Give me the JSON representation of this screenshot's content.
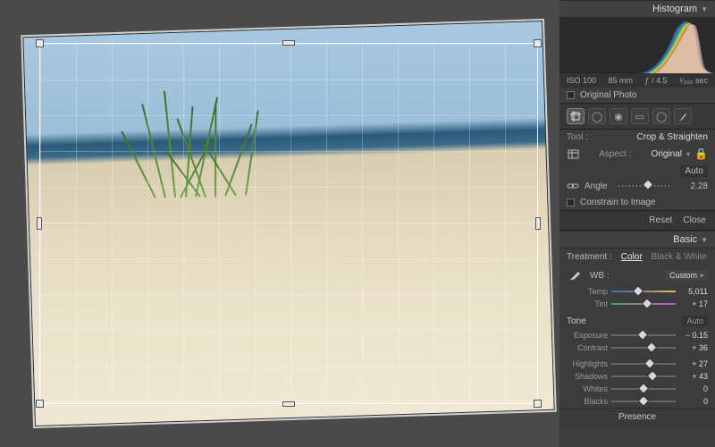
{
  "sections": {
    "histogram": "Histogram",
    "basic": "Basic",
    "presence": "Presence"
  },
  "histo_meta": {
    "iso": "ISO 100",
    "focal": "85 mm",
    "aperture": "ƒ / 4.5",
    "shutter": "¹⁄₂₀₀ sec"
  },
  "original_photo_label": "Original Photo",
  "crop": {
    "tool_label": "Tool :",
    "tool_value": "Crop & Straighten",
    "aspect_label": "Aspect :",
    "aspect_value": "Original",
    "angle_label": "Angle",
    "angle_value": "2.28",
    "auto_label": "Auto",
    "constrain_label": "Constrain to Image",
    "reset": "Reset",
    "close": "Close"
  },
  "basic": {
    "treatment_label": "Treatment :",
    "treatment_color": "Color",
    "treatment_bw": "Black & White",
    "wb_label": "WB :",
    "wb_value": "Custom",
    "temp_label": "Temp",
    "temp_value": "5,011",
    "tint_label": "Tint",
    "tint_value": "+ 17",
    "tone_label": "Tone",
    "auto_label": "Auto",
    "exposure_label": "Exposure",
    "exposure_value": "− 0.15",
    "contrast_label": "Contrast",
    "contrast_value": "+ 36",
    "highlights_label": "Highlights",
    "highlights_value": "+ 27",
    "shadows_label": "Shadows",
    "shadows_value": "+ 43",
    "whites_label": "Whites",
    "whites_value": "0",
    "blacks_label": "Blacks",
    "blacks_value": "0"
  },
  "slider_pos": {
    "temp": 42,
    "tint": 55,
    "exposure": 49,
    "contrast": 62,
    "highlights": 60,
    "shadows": 64,
    "whites": 50,
    "blacks": 50,
    "angle": 56
  }
}
